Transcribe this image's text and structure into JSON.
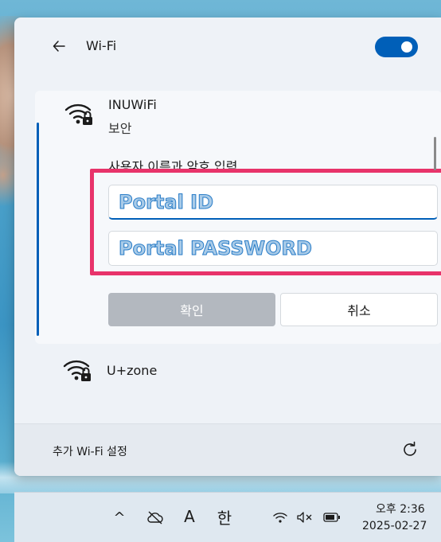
{
  "wifi_panel": {
    "title": "Wi-Fi",
    "toggle_state": "on",
    "networks": [
      {
        "name": "INUWiFi",
        "status": "보안",
        "prompt": "사용자 이름과 암호 입력",
        "username_value": "Portal ID",
        "password_value": "Portal PASSWORD",
        "ok_label": "확인",
        "cancel_label": "취소"
      },
      {
        "name": "U+zone"
      }
    ],
    "more_settings": "추가 Wi-Fi 설정"
  },
  "taskbar": {
    "chevron": "^",
    "ime_mode_a": "A",
    "ime_mode_han": "한",
    "time": "오후 2:36",
    "date": "2025-02-27"
  },
  "icons": {
    "back": "arrow-left-icon",
    "wifi_secure": "wifi-lock-icon",
    "refresh": "refresh-icon",
    "cloud_off": "cloud-off-icon",
    "wifi": "wifi-icon",
    "volume_muted": "volume-muted-icon",
    "battery": "battery-icon"
  },
  "colors": {
    "accent": "#005fb8",
    "highlight_box": "#e8336a"
  }
}
